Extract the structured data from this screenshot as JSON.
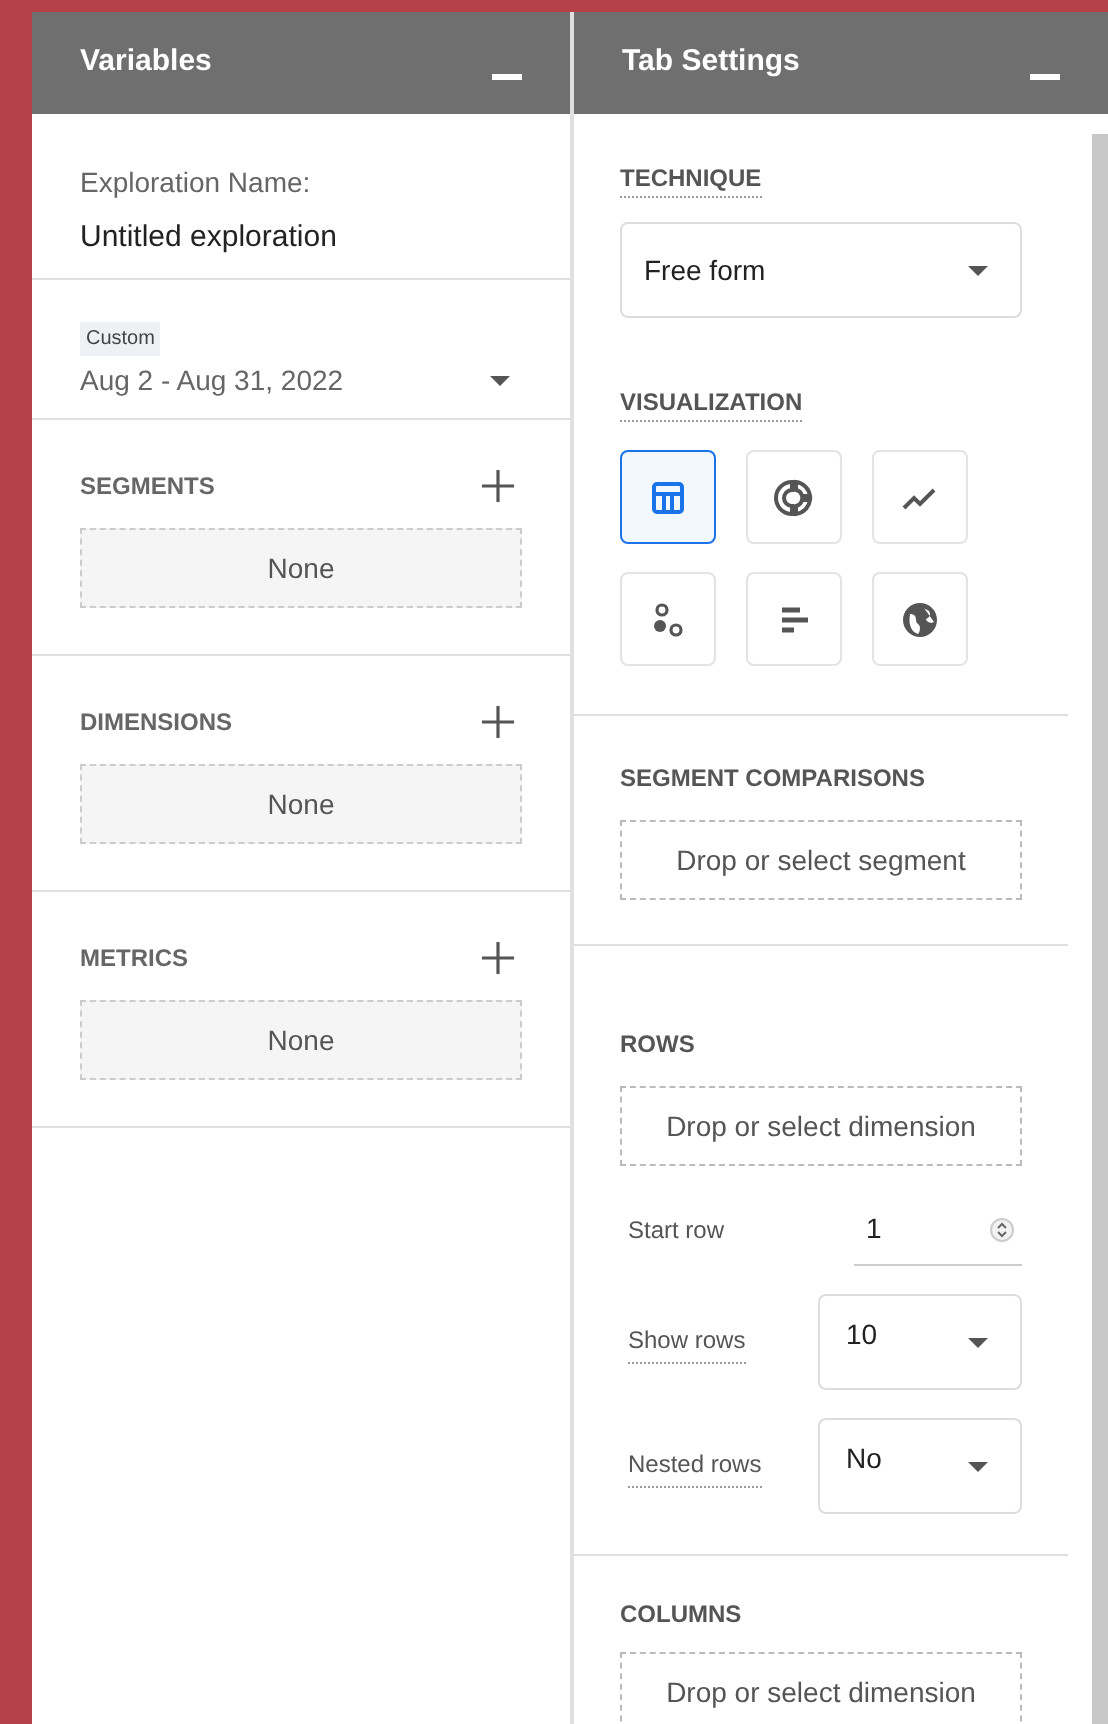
{
  "variables": {
    "title": "Variables",
    "exploration_label": "Exploration Name:",
    "exploration_name": "Untitled exploration",
    "date_badge": "Custom",
    "date_range": "Aug 2 - Aug 31, 2022",
    "sections": [
      {
        "title": "SEGMENTS",
        "empty_text": "None"
      },
      {
        "title": "DIMENSIONS",
        "empty_text": "None"
      },
      {
        "title": "METRICS",
        "empty_text": "None"
      }
    ]
  },
  "tab_settings": {
    "title": "Tab Settings",
    "technique": {
      "label": "TECHNIQUE",
      "value": "Free form"
    },
    "visualization": {
      "label": "VISUALIZATION",
      "options": [
        {
          "kind": "table",
          "selected": true
        },
        {
          "kind": "donut",
          "selected": false
        },
        {
          "kind": "line",
          "selected": false
        },
        {
          "kind": "scatter",
          "selected": false
        },
        {
          "kind": "bar",
          "selected": false
        },
        {
          "kind": "geo",
          "selected": false
        }
      ]
    },
    "segment_comparisons": {
      "label": "SEGMENT COMPARISONS",
      "placeholder": "Drop or select segment"
    },
    "rows": {
      "label": "ROWS",
      "placeholder": "Drop or select dimension",
      "start_row": {
        "label": "Start row",
        "value": "1"
      },
      "show_rows": {
        "label": "Show rows",
        "value": "10"
      },
      "nested_rows": {
        "label": "Nested rows",
        "value": "No"
      }
    },
    "columns": {
      "label": "COLUMNS",
      "placeholder": "Drop or select dimension"
    }
  }
}
